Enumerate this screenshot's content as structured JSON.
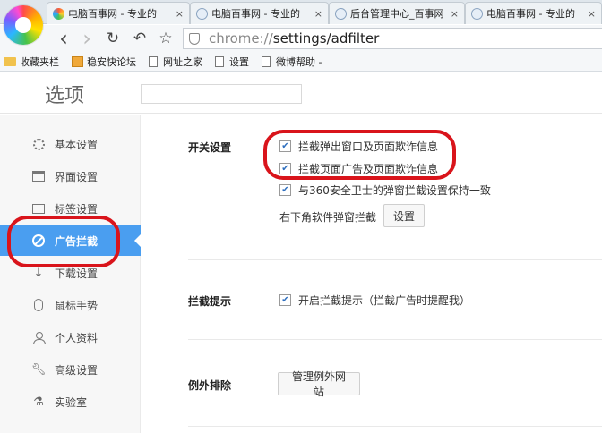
{
  "tabs": [
    {
      "title": "电脑百事网 - 专业的",
      "close": "×"
    },
    {
      "title": "电脑百事网 - 专业的",
      "close": "×"
    },
    {
      "title": "后台管理中心_百事网",
      "close": "×"
    },
    {
      "title": "电脑百事网 - 专业的",
      "close": "×"
    }
  ],
  "nav": {
    "back": "‹",
    "forward": "›",
    "reload": "↻",
    "undo": "↶",
    "star": "☆"
  },
  "address": {
    "scheme": "chrome://",
    "path": "settings/adfilter"
  },
  "bookmarks": [
    "收藏夹栏",
    "稳安快论坛",
    "网址之家",
    "设置",
    "微博帮助 -"
  ],
  "header": {
    "title": "选项",
    "search_placeholder": ""
  },
  "sidebar": {
    "items": [
      {
        "label": "基本设置",
        "icon": "gear-icon"
      },
      {
        "label": "界面设置",
        "icon": "window-icon"
      },
      {
        "label": "标签设置",
        "icon": "tab-icon"
      },
      {
        "label": "广告拦截",
        "icon": "block-icon",
        "active": true
      },
      {
        "label": "下载设置",
        "icon": "download-icon"
      },
      {
        "label": "鼠标手势",
        "icon": "mouse-icon"
      },
      {
        "label": "个人资料",
        "icon": "user-icon"
      },
      {
        "label": "高级设置",
        "icon": "wrench-icon"
      },
      {
        "label": "实验室",
        "icon": "flask-icon"
      }
    ]
  },
  "main": {
    "switch_section": {
      "label": "开关设置",
      "options": [
        {
          "label": "拦截弹出窗口及页面欺诈信息",
          "checked": true
        },
        {
          "label": "拦截页面广告及页面欺诈信息",
          "checked": true
        },
        {
          "label": "与360安全卫士的弹窗拦截设置保持一致",
          "checked": true
        }
      ],
      "corner_label": "右下角软件弹窗拦截",
      "corner_button": "设置"
    },
    "tip_section": {
      "label": "拦截提示",
      "option": {
        "label": "开启拦截提示（拦截广告时提醒我）",
        "checked": true
      }
    },
    "exception_section": {
      "label": "例外排除",
      "button": "管理例外网站"
    }
  },
  "colors": {
    "accent": "#4a9ef0",
    "annotation": "#d9141b",
    "sidebar_bg": "#f7f7f7"
  },
  "check_glyph": "✔"
}
